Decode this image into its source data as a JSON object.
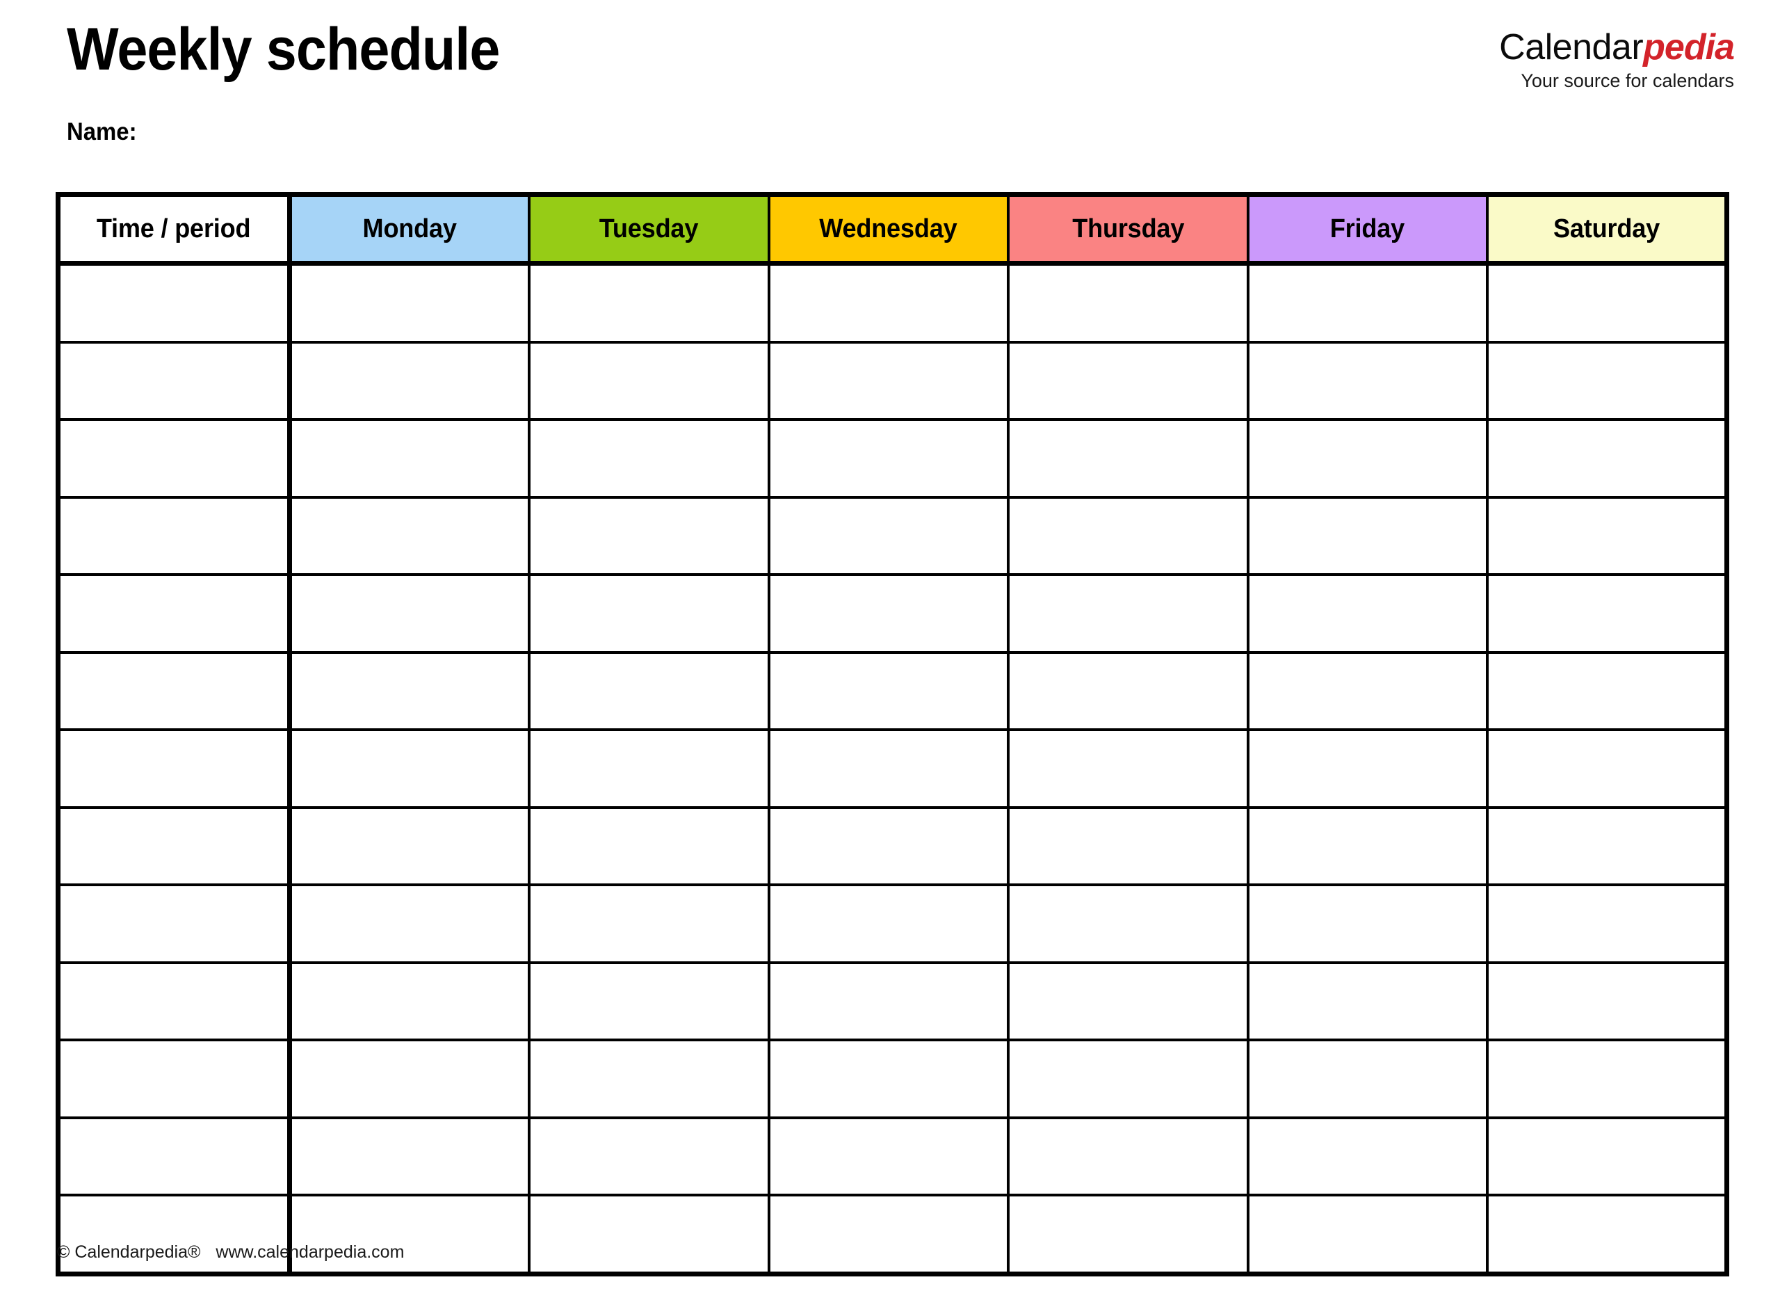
{
  "document": {
    "title": "Weekly schedule",
    "name_label": "Name:"
  },
  "brand": {
    "word_primary": "Calendar",
    "word_accent": "pedia",
    "tagline": "Your source for calendars",
    "accent_color": "#d3232a",
    "primary_color": "#0b0b0b"
  },
  "table": {
    "columns": [
      {
        "label": "Time / period",
        "background": "#ffffff",
        "key": "time"
      },
      {
        "label": "Monday",
        "background": "#a6d4f7",
        "key": "monday"
      },
      {
        "label": "Tuesday",
        "background": "#96cc16",
        "key": "tuesday"
      },
      {
        "label": "Wednesday",
        "background": "#ffc800",
        "key": "wednesday"
      },
      {
        "label": "Thursday",
        "background": "#fa8383",
        "key": "thursday"
      },
      {
        "label": "Friday",
        "background": "#cb99fb",
        "key": "friday"
      },
      {
        "label": "Saturday",
        "background": "#fafac8",
        "key": "saturday"
      }
    ],
    "row_count": 13,
    "rows": [
      {
        "time": "",
        "monday": "",
        "tuesday": "",
        "wednesday": "",
        "thursday": "",
        "friday": "",
        "saturday": ""
      },
      {
        "time": "",
        "monday": "",
        "tuesday": "",
        "wednesday": "",
        "thursday": "",
        "friday": "",
        "saturday": ""
      },
      {
        "time": "",
        "monday": "",
        "tuesday": "",
        "wednesday": "",
        "thursday": "",
        "friday": "",
        "saturday": ""
      },
      {
        "time": "",
        "monday": "",
        "tuesday": "",
        "wednesday": "",
        "thursday": "",
        "friday": "",
        "saturday": ""
      },
      {
        "time": "",
        "monday": "",
        "tuesday": "",
        "wednesday": "",
        "thursday": "",
        "friday": "",
        "saturday": ""
      },
      {
        "time": "",
        "monday": "",
        "tuesday": "",
        "wednesday": "",
        "thursday": "",
        "friday": "",
        "saturday": ""
      },
      {
        "time": "",
        "monday": "",
        "tuesday": "",
        "wednesday": "",
        "thursday": "",
        "friday": "",
        "saturday": ""
      },
      {
        "time": "",
        "monday": "",
        "tuesday": "",
        "wednesday": "",
        "thursday": "",
        "friday": "",
        "saturday": ""
      },
      {
        "time": "",
        "monday": "",
        "tuesday": "",
        "wednesday": "",
        "thursday": "",
        "friday": "",
        "saturday": ""
      },
      {
        "time": "",
        "monday": "",
        "tuesday": "",
        "wednesday": "",
        "thursday": "",
        "friday": "",
        "saturday": ""
      },
      {
        "time": "",
        "monday": "",
        "tuesday": "",
        "wednesday": "",
        "thursday": "",
        "friday": "",
        "saturday": ""
      },
      {
        "time": "",
        "monday": "",
        "tuesday": "",
        "wednesday": "",
        "thursday": "",
        "friday": "",
        "saturday": ""
      },
      {
        "time": "",
        "monday": "",
        "tuesday": "",
        "wednesday": "",
        "thursday": "",
        "friday": "",
        "saturday": ""
      }
    ]
  },
  "footer": {
    "copyright": "© Calendarpedia®",
    "website": "www.calendarpedia.com"
  }
}
